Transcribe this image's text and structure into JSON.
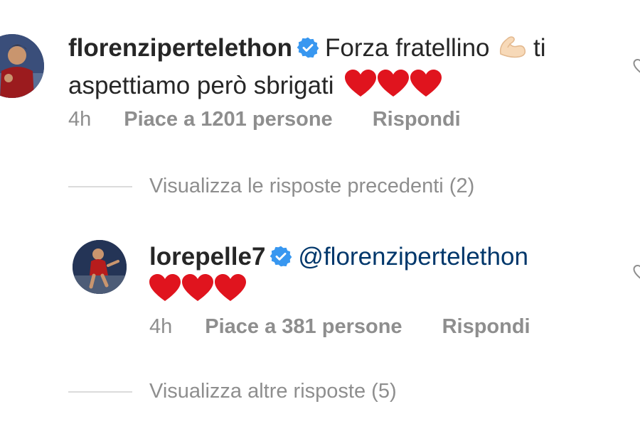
{
  "comment": {
    "username": "florenzipertelethon",
    "text_line1": "Forza fratellino",
    "text_after_emoji": "ti",
    "text_line2": "aspettiamo però sbrigati",
    "emoji_flex": "flexed-biceps-icon",
    "hearts": 3,
    "time": "4h",
    "likes": "Piace a 1201 persone",
    "reply": "Rispondi",
    "verified": true
  },
  "view_previous_replies": "Visualizza le risposte precedenti (2)",
  "reply": {
    "username": "lorepelle7",
    "mention": "@florenzipertelethon",
    "hearts": 3,
    "time": "4h",
    "likes": "Piace a 381 persone",
    "reply": "Rispondi",
    "verified": true
  },
  "view_more_replies": "Visualizza altre risposte (5)",
  "colors": {
    "text": "#262626",
    "secondary": "#8e8e8e",
    "verified": "#3897f0",
    "heart": "#e0141e",
    "mention": "#00376b"
  }
}
